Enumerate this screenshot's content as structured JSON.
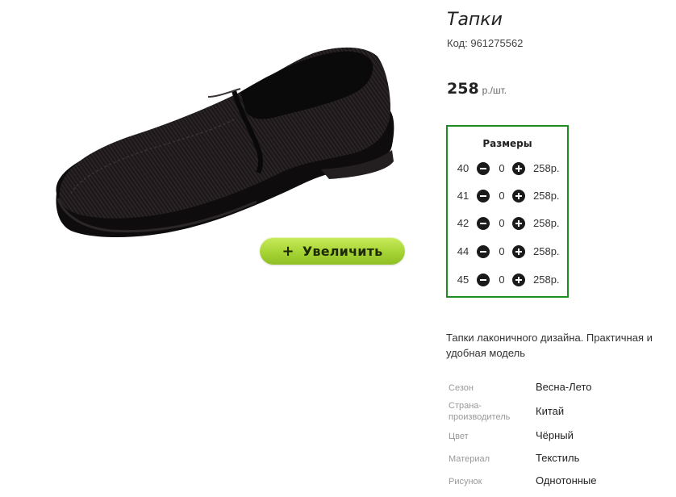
{
  "product": {
    "title": "Тапки",
    "code_label": "Код:",
    "code_value": "961275562",
    "price": "258",
    "price_unit": "р./шт.",
    "zoom_button_label": "Увеличить",
    "zoom_button_icon": "+",
    "description": "Тапки лаконичного дизайна. Практичная и удобная модель"
  },
  "sizes": {
    "title": "Размеры",
    "rows": [
      {
        "size": "40",
        "qty": "0",
        "price": "258р."
      },
      {
        "size": "41",
        "qty": "0",
        "price": "258р."
      },
      {
        "size": "42",
        "qty": "0",
        "price": "258р."
      },
      {
        "size": "44",
        "qty": "0",
        "price": "258р."
      },
      {
        "size": "45",
        "qty": "0",
        "price": "258р."
      }
    ]
  },
  "specs": [
    {
      "label": "Сезон",
      "value": "Весна-Лето"
    },
    {
      "label": "Страна-производитель",
      "label_line1": "Страна-",
      "label_line2": "производитель",
      "value": "Китай"
    },
    {
      "label": "Цвет",
      "value": "Чёрный"
    },
    {
      "label": "Материал",
      "value": "Текстиль"
    },
    {
      "label": "Рисунок",
      "value": "Однотонные"
    }
  ],
  "colors": {
    "accent_border": "#1e8c24",
    "button_green": "#a6d435",
    "text_dark": "#222222",
    "label_gray": "#999999"
  },
  "icons": {
    "minus": "minus-circle-icon",
    "plus": "plus-circle-icon"
  }
}
